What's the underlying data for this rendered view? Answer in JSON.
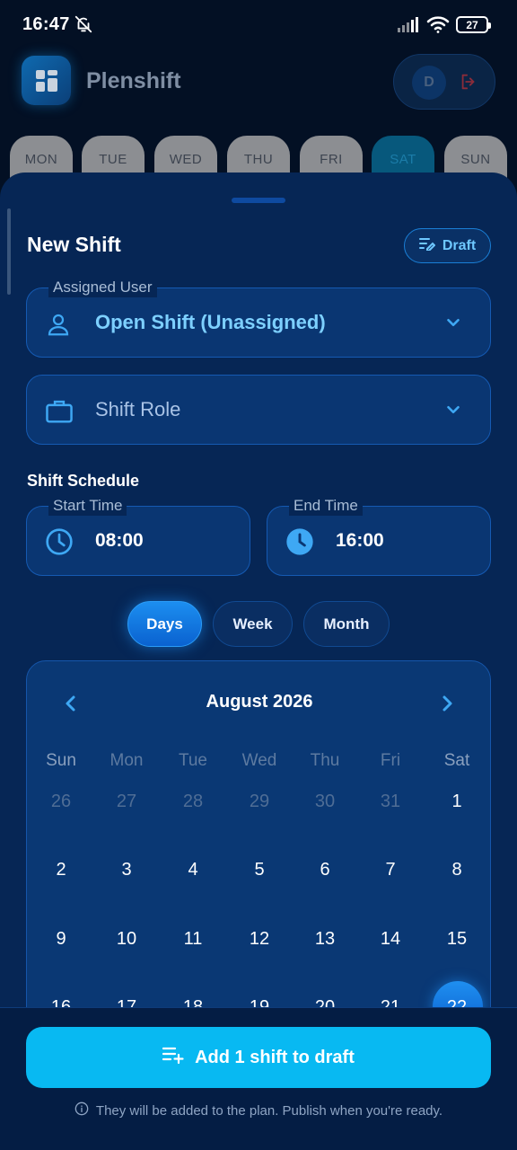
{
  "status_bar": {
    "time": "16:47",
    "battery": "27"
  },
  "header": {
    "app_name": "Plenshift",
    "avatar_initial": "D"
  },
  "day_tabs": [
    "MON",
    "TUE",
    "WED",
    "THU",
    "FRI",
    "SAT",
    "SUN"
  ],
  "active_day": "SAT",
  "sheet": {
    "title": "New Shift",
    "draft_label": "Draft",
    "assigned_user": {
      "label": "Assigned User",
      "value": "Open Shift (Unassigned)"
    },
    "shift_role": {
      "placeholder": "Shift Role"
    },
    "schedule_title": "Shift Schedule",
    "start_time": {
      "label": "Start Time",
      "value": "08:00"
    },
    "end_time": {
      "label": "End Time",
      "value": "16:00"
    },
    "view_modes": [
      "Days",
      "Week",
      "Month"
    ],
    "active_view": "Days",
    "calendar": {
      "month_label": "August 2026",
      "weekdays": [
        "Sun",
        "Mon",
        "Tue",
        "Wed",
        "Thu",
        "Fri",
        "Sat"
      ],
      "weeks": [
        [
          "26",
          "27",
          "28",
          "29",
          "30",
          "31",
          "1"
        ],
        [
          "2",
          "3",
          "4",
          "5",
          "6",
          "7",
          "8"
        ],
        [
          "9",
          "10",
          "11",
          "12",
          "13",
          "14",
          "15"
        ],
        [
          "16",
          "17",
          "18",
          "19",
          "20",
          "21",
          "22"
        ]
      ],
      "selected_day": "22"
    }
  },
  "footer": {
    "cta_label": "Add 1 shift to draft",
    "hint": "They will be added to the plan. Publish when you're ready."
  },
  "colors": {
    "accent": "#08b9f2",
    "sheet_bg": "#062655",
    "field_bg": "#0a3672"
  }
}
